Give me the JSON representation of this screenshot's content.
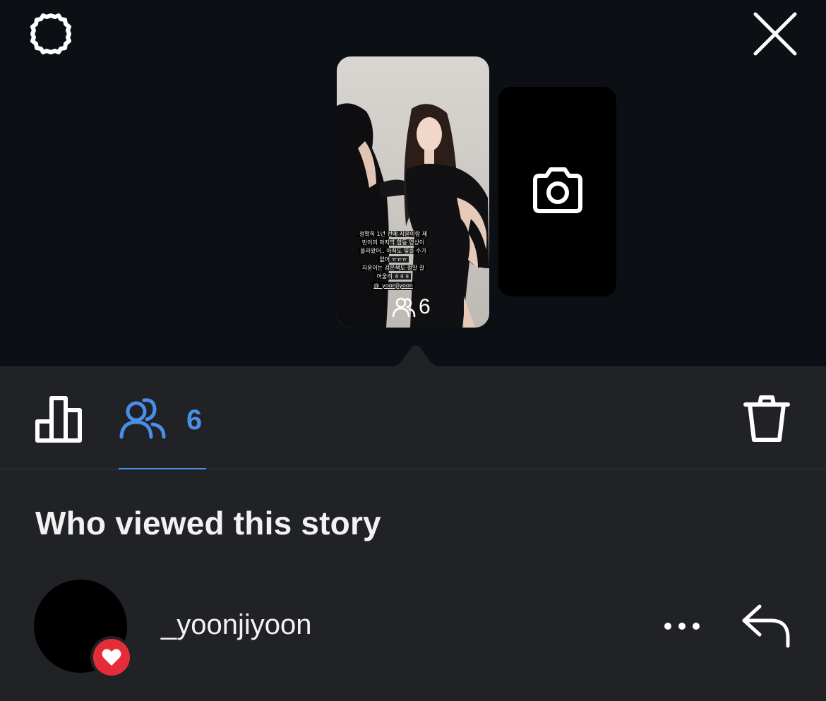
{
  "header": {
    "settings_icon": "gear-icon",
    "close_icon": "close-icon"
  },
  "story": {
    "caption_lines": [
      "정확히 1년 전에 지윤이랑 제",
      "민이의 마지막 합동 영상이",
      "올라왔어.. 아직도 잊을 수가",
      "없어 ㅠㅠㅠ",
      "지윤이는 검은색도 정말 잘",
      "어울려 ㅎㅎㅎ"
    ],
    "mention": "@_yoonjiyoon",
    "viewer_count": "6"
  },
  "add_story": {
    "icon": "camera-icon"
  },
  "tabs": {
    "insights_icon": "bar-chart-icon",
    "viewers_icon": "people-icon",
    "viewers_count": "6",
    "delete_icon": "trash-icon",
    "active": "viewers",
    "accent_color": "#4a8fe7"
  },
  "viewers_section": {
    "title": "Who viewed this story",
    "viewers": [
      {
        "username": "_yoonjiyoon",
        "liked": true
      }
    ]
  },
  "colors": {
    "top_bg": "#0c1014",
    "panel_bg": "#202226",
    "like_red": "#e52d39"
  }
}
